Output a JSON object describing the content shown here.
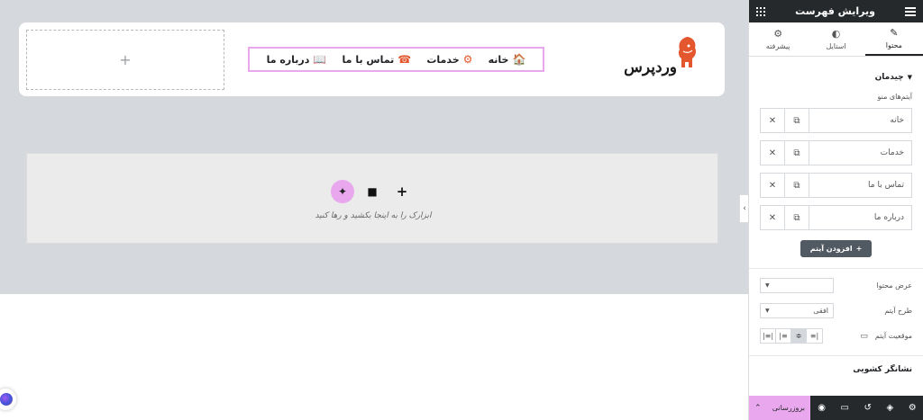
{
  "canvas": {
    "empty_column_plus": "+",
    "logo_text": "وردپرس",
    "nav": [
      {
        "label": "خانه",
        "icon": "house-icon",
        "emoji": "🏠"
      },
      {
        "label": "خدمات",
        "icon": "settings-icon",
        "emoji": "⚙"
      },
      {
        "label": "تماس با ما",
        "icon": "phone-icon",
        "emoji": "☎"
      },
      {
        "label": "درباره ما",
        "icon": "book-icon",
        "emoji": "📖"
      }
    ],
    "drop_zone": {
      "text": "ابزارک را به اینجا بکشید و رها کنید",
      "ai_icon": "✦",
      "folder_icon": "■",
      "plus_icon": "+"
    },
    "collapse_icon": "‹"
  },
  "panel": {
    "title": "ویرایش فهرست",
    "tabs": [
      {
        "label": "محتوا",
        "icon": "✎",
        "active": true
      },
      {
        "label": "استایل",
        "icon": "◐",
        "active": false
      },
      {
        "label": "پیشرفته",
        "icon": "⚙",
        "active": false
      }
    ],
    "section_layout": "چیدمان",
    "menu_items_label": "آیتم‌های منو",
    "menu_items": [
      "خانه",
      "خدمات",
      "تماس با ما",
      "درباره ما"
    ],
    "add_item": "افزودن آیتم",
    "content_width_label": "عرض محتوا",
    "content_width_value": "",
    "item_layout_label": "طرح آیتم",
    "item_layout_value": "افقی",
    "item_position_label": "موقعیت آیتم",
    "indicator_section": "نشانگر کشویی",
    "publish_label": "بروزرسانی"
  },
  "colors": {
    "accent": "#e9a8ee",
    "dark": "#26292c",
    "canvas_gray": "#d5d8dc"
  }
}
